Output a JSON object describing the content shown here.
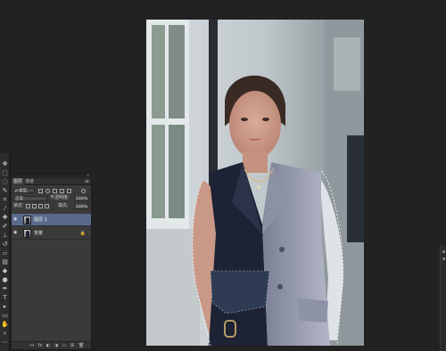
{
  "toolbar": {
    "tools": [
      {
        "name": "move-tool-icon",
        "glyph": "✥"
      },
      {
        "name": "marquee-tool-icon",
        "glyph": "⬚"
      },
      {
        "name": "lasso-tool-icon",
        "glyph": "◌"
      },
      {
        "name": "quick-select-tool-icon",
        "glyph": "✎"
      },
      {
        "name": "crop-tool-icon",
        "glyph": "⌗"
      },
      {
        "name": "eyedropper-tool-icon",
        "glyph": "⁄"
      },
      {
        "name": "healing-brush-tool-icon",
        "glyph": "✚"
      },
      {
        "name": "brush-tool-icon",
        "glyph": "✐"
      },
      {
        "name": "clone-stamp-tool-icon",
        "glyph": "⊥"
      },
      {
        "name": "history-brush-tool-icon",
        "glyph": "↺"
      },
      {
        "name": "eraser-tool-icon",
        "glyph": "▱"
      },
      {
        "name": "gradient-tool-icon",
        "glyph": "▤"
      },
      {
        "name": "blur-tool-icon",
        "glyph": "◆"
      },
      {
        "name": "dodge-tool-icon",
        "glyph": "●"
      },
      {
        "name": "pen-tool-icon",
        "glyph": "✒"
      },
      {
        "name": "type-tool-icon",
        "glyph": "T"
      },
      {
        "name": "path-select-tool-icon",
        "glyph": "▸"
      },
      {
        "name": "shape-tool-icon",
        "glyph": "▭"
      },
      {
        "name": "hand-tool-icon",
        "glyph": "✋"
      },
      {
        "name": "zoom-tool-icon",
        "glyph": "⌕"
      },
      {
        "name": "more-tools-icon",
        "glyph": "⋯"
      }
    ]
  },
  "layers_panel": {
    "collapse_glyph": "»",
    "tabs": {
      "layers": "图层",
      "channels": "通道"
    },
    "menu_glyph": "≡",
    "filter": {
      "kind": "ρ 类型"
    },
    "blend": {
      "mode": "正常",
      "opacity_label": "不透明度:",
      "opacity": "100%"
    },
    "lock": {
      "label": "锁定:",
      "fill_label": "填充:",
      "fill": "100%"
    },
    "layers": [
      {
        "name": "图层 1",
        "visible": "◉",
        "selected": true,
        "locked": ""
      },
      {
        "name": "背景",
        "visible": "◉",
        "selected": false,
        "locked": "🔒"
      }
    ],
    "bottom_icons": [
      "⊶",
      "fx",
      "◐",
      "◑",
      "▭",
      "⊞",
      "🗑"
    ]
  },
  "canvas": {
    "accent_colors": {
      "vest_dark": "#1d2235",
      "vest_light": "#a4a8b9",
      "wall": "#c2cbd0",
      "skin": "#cc9d8b"
    }
  }
}
